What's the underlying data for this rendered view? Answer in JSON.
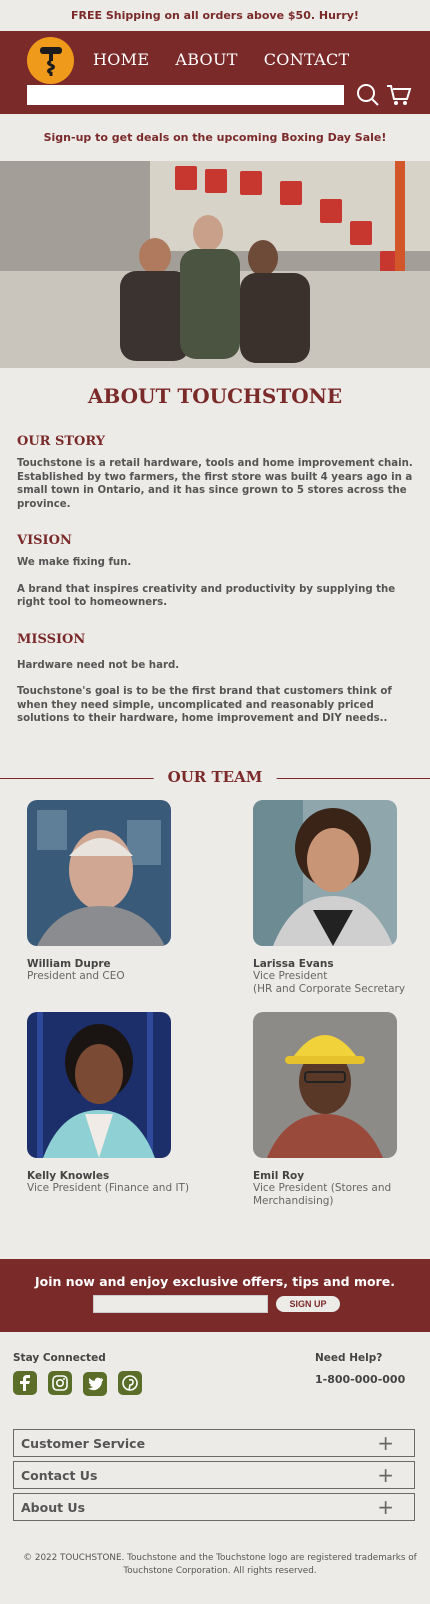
{
  "announcement": "FREE Shipping on all orders above $50. Hurry!",
  "nav": {
    "items": [
      "HOME",
      "ABOUT",
      "CONTACT"
    ]
  },
  "search": {
    "placeholder": ""
  },
  "promo": "Sign-up to get deals on the upcoming Boxing Day Sale!",
  "about": {
    "title": "ABOUT TOUCHSTONE",
    "story_heading": "OUR STORY",
    "story_text": "Touchstone is a retail hardware, tools and home improvement chain. Established by two farmers, the first store was built 4 years ago in a small town in Ontario, and it has since grown to 5 stores across the province.",
    "vision_heading": "VISION",
    "vision_text_1": "We make fixing fun.",
    "vision_text_2": "A brand that inspires creativity and productivity by supplying the right tool to homeowners.",
    "mission_heading": "MISSION",
    "mission_text_1": "Hardware need not be hard.",
    "mission_text_2": "Touchstone's goal is to be the first brand that customers think of when they need simple, uncomplicated and reasonably priced solutions to their hardware, home improvement and DIY needs.."
  },
  "team": {
    "heading": "OUR TEAM",
    "members": [
      {
        "name": "William Dupre",
        "role": "President and CEO"
      },
      {
        "name": "Larissa Evans",
        "role": "Vice President\n(HR and Corporate Secretary"
      },
      {
        "name": "Kelly Knowles",
        "role": "Vice President (Finance and IT)"
      },
      {
        "name": "Emil Roy",
        "role": "Vice President (Stores and Merchandising)"
      }
    ]
  },
  "join": {
    "text": "Join now and enjoy exclusive offers, tips and more.",
    "button": "SIGN UP"
  },
  "footer": {
    "stay_connected": "Stay Connected",
    "need_help": "Need Help?",
    "phone": "1-800-000-000",
    "accordions": [
      "Customer Service",
      "Contact Us",
      "About Us"
    ],
    "copyright": "© 2022 TOUCHSTONE. Touchstone and the Touchstone logo are registered trademarks of Touchstone Corporation. All rights reserved."
  },
  "colors": {
    "brand": "#7b2a2a",
    "accent": "#f09a1b",
    "social": "#5a6e2a"
  }
}
